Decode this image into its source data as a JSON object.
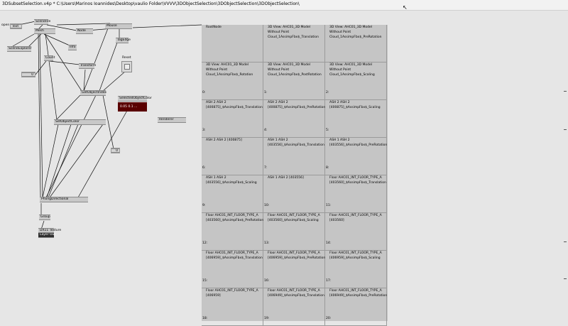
{
  "title": "3DSubsetSelection.v4p *  C:\\Users\\Marinos Ioannides\\Desktop\\vaulio Folder\\VVVV\\3DObjectSelection\\3DObjectSelection\\3DObjectSelection\\",
  "nodes": {
    "open_label": "open",
    "text": "Text",
    "scenefile": "SceneFile",
    "mesh": "Mesh",
    "node": "Node",
    "mouse": "Mouse",
    "scene_explorer": "SceneExplorer",
    "info": "Info",
    "tagedge": "TagEdge",
    "count": "Count",
    "reset": "Reset",
    "zero1": "0",
    "transform": "Transform",
    "get_object_index": "GetObjectIndex",
    "selected_object_color": "SelectedObjectColor",
    "selected_color_value": "0.05  0.1 ...",
    "set_object_color": "SetObjectColor",
    "renderer": "Renderer",
    "zero2": "0",
    "phong": "PhongDirectional",
    "group": "Group",
    "dx11": "DX11 Texture",
    "layer_out": "Layer Out"
  },
  "cells": [
    {
      "idx": "",
      "text": "RootNode"
    },
    {
      "idx": "",
      "text": "3D View: AHC01_3D Model Without Point Cloud_1AssimpFbx$_Translation"
    },
    {
      "idx": "",
      "text": "3D View: AHC01_3D Model Without Point Cloud_1AssimpFbx$_PreRotation"
    },
    {
      "idx": "0:",
      "text": "3D View: AHC01_3D Model Without Point Cloud_1AssimpFbx$_Rotation"
    },
    {
      "idx": "1:",
      "text": "3D View: AHC01_3D Model Without Point Cloud_1AssimpFbx$_PostRotation"
    },
    {
      "idx": "2:",
      "text": "3D View: AHC01_3D Model Without Point Cloud_1AssimpFbx$_Scaling"
    },
    {
      "idx": "3:",
      "text": "ASH 2 ASH 2 [400875]_$AssimpFbx$_Translation"
    },
    {
      "idx": "4:",
      "text": "ASH 2 ASH 2 [400875]_$AssimpFbx$_PreRotation"
    },
    {
      "idx": "5:",
      "text": "ASH 2 ASH 2 [400875]_$AssimpFbx$_Scaling"
    },
    {
      "idx": "6:",
      "text": "ASH 2 ASH 2 [400875]"
    },
    {
      "idx": "7:",
      "text": "ASH 1 ASH 2 [403556]_$AssimpFbx$_Translation"
    },
    {
      "idx": "8:",
      "text": "ASH 1 ASH 2 [403556]_$AssimpFbx$_PreRotation"
    },
    {
      "idx": "9:",
      "text": "ASH 1 ASH 2 [403556]_$AssimpFbx$_Scaling"
    },
    {
      "idx": "10:",
      "text": "ASH 1 ASH 2 [403556]"
    },
    {
      "idx": "11:",
      "text": "Floor AHC01_INT_FLOOR_TYPE_A [403560]_$AssimpFbx$_Translation"
    },
    {
      "idx": "12:",
      "text": "Floor AHC01_INT_FLOOR_TYPE_A [403560]_$AssimpFbx$_PreRotation"
    },
    {
      "idx": "13:",
      "text": "Floor AHC01_INT_FLOOR_TYPE_A [403560]_$AssimpFbx$_Scaling"
    },
    {
      "idx": "14:",
      "text": "Floor AHC01_INT_FLOOR_TYPE_A [403560]"
    },
    {
      "idx": "15:",
      "text": "Floor AHC01_INT_FLOOR_TYPE_A [406959]_$AssimpFbx$_Translation"
    },
    {
      "idx": "16:",
      "text": "Floor AHC01_INT_FLOOR_TYPE_A [406959]_$AssimpFbx$_PreRotation"
    },
    {
      "idx": "17:",
      "text": "Floor AHC01_INT_FLOOR_TYPE_A [406959]_$AssimpFbx$_Scaling"
    },
    {
      "idx": "18:",
      "text": "Floor AHC01_INT_FLOOR_TYPE_A [406959]"
    },
    {
      "idx": "19:",
      "text": "Floor AHC01_INT_FLOOR_TYPE_A [406949]_$AssimpFbx$_Translation"
    },
    {
      "idx": "20:",
      "text": "Floor AHC01_INT_FLOOR_TYPE_A [406949]_$AssimpFbx$_PreRotation"
    }
  ]
}
